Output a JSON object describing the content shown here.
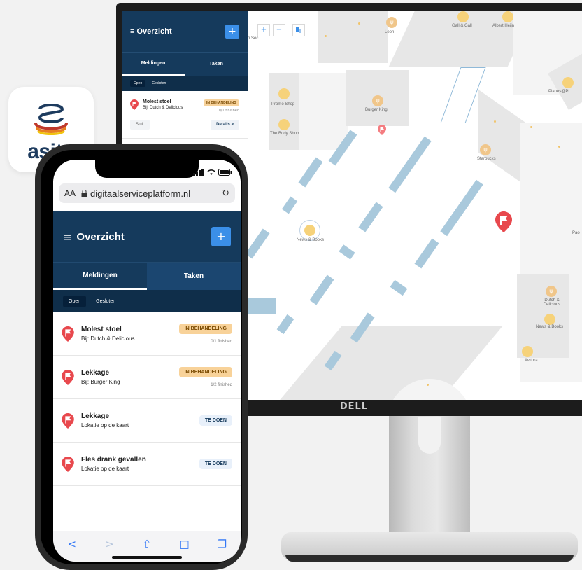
{
  "desktop": {
    "title": "Overzicht",
    "plus": "+",
    "tabs": [
      "Meldingen",
      "Taken"
    ],
    "chips": [
      "Open",
      "Gesloten"
    ],
    "item": {
      "title": "Molest stoel",
      "sub": "Bij: Dutch & Delicious",
      "badge": "IN BEHANDELING",
      "finished": "0/1 finished",
      "close": "Sluit",
      "details": "Details  >"
    },
    "brand": "DELL"
  },
  "map": {
    "controls": [
      "+",
      "−"
    ],
    "labels": {
      "leon": "Leon",
      "gall": "Gall & Gall",
      "ah": "Albert Heijn",
      "promo": "Promo Shop",
      "bk": "Burger King",
      "bodyshop": "The Body Shop",
      "starbucks": "Starbucks",
      "planes": "Planes@Pl",
      "news1": "News & Books",
      "dutch": "Dutch & Delicious",
      "news2": "News & Books",
      "avitora": "Avitora",
      "pao": "Pao",
      "sec": "n Sec"
    }
  },
  "logo": {
    "text": "asito"
  },
  "phone": {
    "aa": "AA",
    "url": "digitaalserviceplatform.nl",
    "reload": "↻",
    "title": "Overzicht",
    "burger": "≡",
    "plus": "+",
    "tabs": [
      "Meldingen",
      "Taken"
    ],
    "chips": [
      "Open",
      "Gesloten"
    ],
    "items": [
      {
        "title": "Molest stoel",
        "sub": "Bij: Dutch & Delicious",
        "badge": "IN BEHANDELING",
        "finished": "0/1 finished"
      },
      {
        "title": "Lekkage",
        "sub": "Bij: Burger King",
        "badge": "IN BEHANDELING",
        "finished": "1/2 finished"
      },
      {
        "title": "Lekkage",
        "sub": "Lokatie op de kaart",
        "badge": "TE DOEN",
        "finished": ""
      },
      {
        "title": "Fles drank gevallen",
        "sub": "Lokatie op de kaart",
        "badge": "TE DOEN",
        "finished": ""
      }
    ],
    "toolbar": {
      "back": "<",
      "forward": ">",
      "share": "⇧",
      "bookmarks": "□",
      "tabs": "❐"
    }
  },
  "colors": {
    "navy": "#153a5c",
    "accent": "#3b8fe8",
    "pin": "#e8484d",
    "badgeProgress": "#f8d299",
    "badgeTodo": "#e8f0fa"
  }
}
